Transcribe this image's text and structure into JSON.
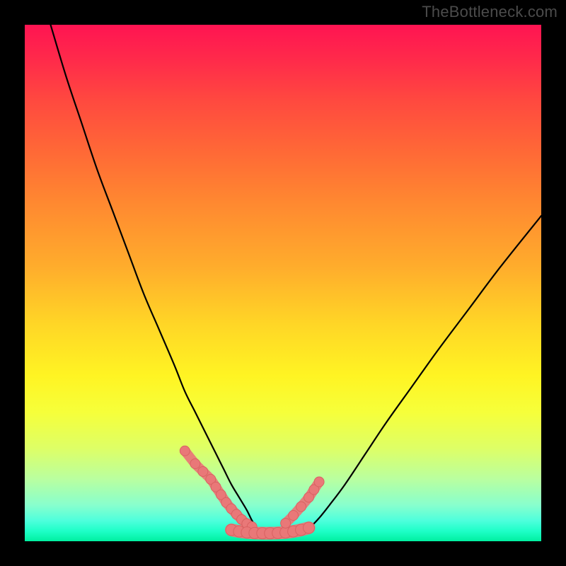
{
  "watermark": "TheBottleneck.com",
  "chart_data": {
    "type": "line",
    "title": "",
    "xlabel": "",
    "ylabel": "",
    "xlim": [
      0,
      100
    ],
    "ylim": [
      0,
      100
    ],
    "grid": false,
    "series": [
      {
        "name": "left-curve",
        "x": [
          5,
          8,
          11,
          14,
          17,
          20,
          23,
          26,
          29,
          31,
          33,
          35,
          37,
          38.5,
          40,
          41.5,
          43,
          44,
          45
        ],
        "y": [
          100,
          90,
          81,
          72,
          64,
          56,
          48,
          41,
          34,
          29,
          25,
          21,
          17,
          14,
          11,
          8.5,
          6,
          4,
          2.5
        ]
      },
      {
        "name": "plateau",
        "x": [
          45,
          47,
          49,
          51,
          53,
          55
        ],
        "y": [
          2.2,
          1.8,
          1.6,
          1.6,
          1.8,
          2.4
        ]
      },
      {
        "name": "right-curve",
        "x": [
          55,
          57,
          59,
          62,
          66,
          70,
          75,
          80,
          86,
          92,
          100
        ],
        "y": [
          2.4,
          4.5,
          7,
          11,
          17,
          23,
          30,
          37,
          45,
          53,
          63
        ]
      },
      {
        "name": "left-markers",
        "x": [
          31,
          33,
          34.5,
          36,
          37,
          38,
          39,
          40,
          41,
          42,
          43,
          44
        ],
        "y": [
          17.5,
          15,
          13.5,
          12,
          10.5,
          9,
          7.5,
          6.3,
          5.2,
          4.2,
          3.4,
          2.8
        ]
      },
      {
        "name": "bottom-markers",
        "x": [
          40,
          41.5,
          43,
          44.5,
          46,
          47.5,
          49,
          50.5,
          52,
          53.5,
          55
        ],
        "y": [
          2.2,
          1.9,
          1.7,
          1.6,
          1.55,
          1.55,
          1.6,
          1.7,
          1.9,
          2.2,
          2.6
        ]
      },
      {
        "name": "right-markers",
        "x": [
          50.5,
          52,
          53.5,
          55,
          56,
          57
        ],
        "y": [
          3.5,
          5,
          6.7,
          8.5,
          10,
          11.5
        ]
      }
    ],
    "colors": {
      "curve": "#000000",
      "marker_fill": "#e97878",
      "marker_stroke": "#d96262"
    }
  }
}
